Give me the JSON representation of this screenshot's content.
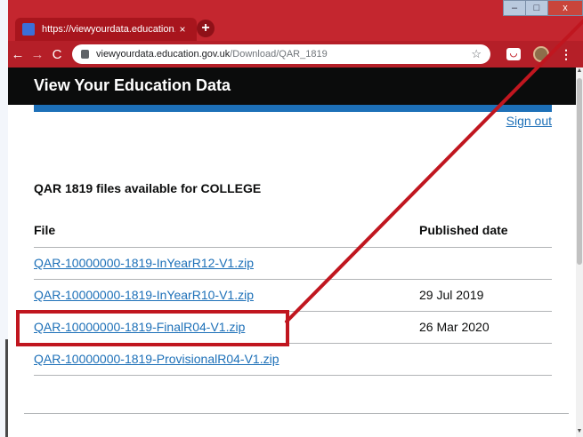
{
  "browser": {
    "tab_title": "https://viewyourdata.education.g",
    "tab_close": "×",
    "new_tab": "+",
    "url_host": "viewyourdata.education.gov.uk",
    "url_path": "/Download/QAR_1819",
    "star": "☆",
    "menu": "⋮",
    "back": "←",
    "forward": "→",
    "reload": "C",
    "window_min": "–",
    "window_max": "□",
    "window_close": "x"
  },
  "site": {
    "title": "View Your Education Data",
    "sign_out": "Sign out"
  },
  "main": {
    "heading": "QAR 1819 files available for COLLEGE",
    "columns": [
      "File",
      "Published date"
    ],
    "rows": [
      {
        "file": "QAR-10000000-1819-InYearR12-V1.zip",
        "date": ""
      },
      {
        "file": "QAR-10000000-1819-InYearR10-V1.zip",
        "date": "29 Jul 2019"
      },
      {
        "file": "QAR-10000000-1819-FinalR04-V1.zip",
        "date": "26 Mar 2020"
      },
      {
        "file": "QAR-10000000-1819-ProvisionalR04-V1.zip",
        "date": ""
      }
    ]
  },
  "colors": {
    "chrome_accent": "#c4262f",
    "gov_header": "#0b0c0c",
    "gov_blue": "#1d70b8",
    "annotation": "#c0161f"
  }
}
